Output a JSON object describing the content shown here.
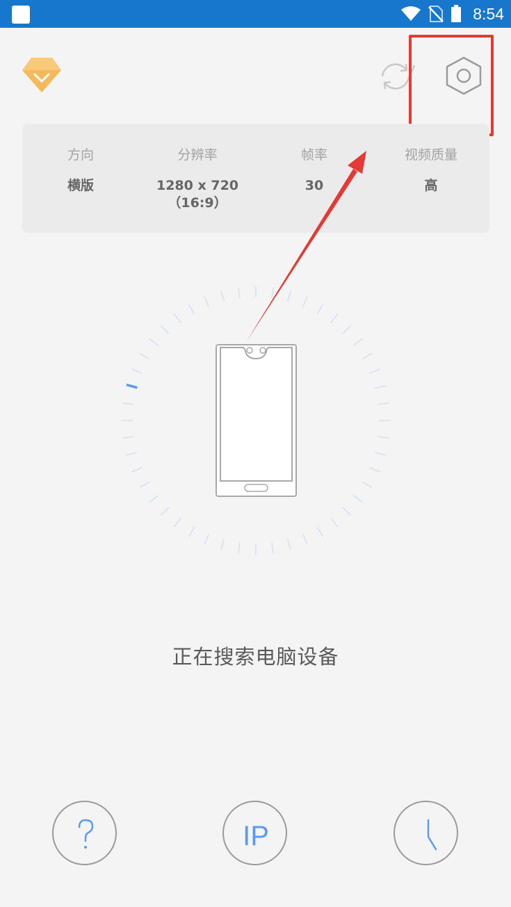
{
  "status_bar": {
    "time": "8:54",
    "background": "#1777cc"
  },
  "toolbar": {
    "vip_icon": "diamond-icon",
    "refresh_icon": "refresh-icon",
    "settings_icon": "hexagon-settings-icon"
  },
  "settings_panel": {
    "items": [
      {
        "label": "方向",
        "value": "横版",
        "sub": ""
      },
      {
        "label": "分辨率",
        "value": "1280 x 720",
        "sub": "（16:9）"
      },
      {
        "label": "帧率",
        "value": "30",
        "sub": ""
      },
      {
        "label": "视频质量",
        "value": "高",
        "sub": ""
      }
    ]
  },
  "search": {
    "status": "正在搜索电脑设备"
  },
  "bottom_buttons": {
    "help_icon": "question-icon",
    "ip_label": "IP",
    "history_icon": "clock-icon"
  },
  "colors": {
    "accent": "#5b9bef",
    "highlight": "#e53935",
    "vip": "#f4b95a"
  }
}
